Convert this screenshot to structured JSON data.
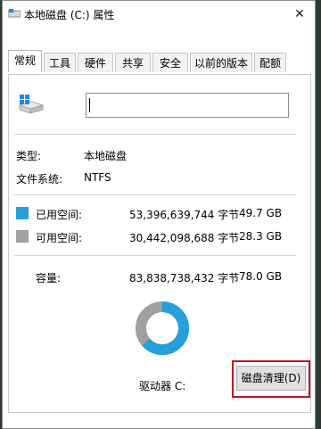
{
  "window": {
    "title": "本地磁盘 (C:) 属性",
    "close_symbol": "✕"
  },
  "tabs": [
    {
      "label": "常规",
      "active": true
    },
    {
      "label": "工具",
      "active": false
    },
    {
      "label": "硬件",
      "active": false
    },
    {
      "label": "共享",
      "active": false
    },
    {
      "label": "安全",
      "active": false
    },
    {
      "label": "以前的版本",
      "active": false
    },
    {
      "label": "配额",
      "active": false
    }
  ],
  "general": {
    "name_value": "",
    "type_label": "类型:",
    "type_value": "本地磁盘",
    "fs_label": "文件系统:",
    "fs_value": "NTFS",
    "used": {
      "label": "已用空间:",
      "bytes": "53,396,639,744 字节",
      "size": "49.7 GB",
      "color": "#26a0da"
    },
    "free": {
      "label": "可用空间:",
      "bytes": "30,442,098,688 字节",
      "size": "28.3 GB",
      "color": "#a0a0a0"
    },
    "capacity": {
      "label": "容量:",
      "bytes": "83,838,738,432 字节",
      "size": "78.0 GB"
    },
    "used_fraction": 0.637,
    "drive_label": "驱动器 C:",
    "cleanup_button": "磁盘清理(D)"
  },
  "colors": {
    "highlight": "#c4131c"
  }
}
